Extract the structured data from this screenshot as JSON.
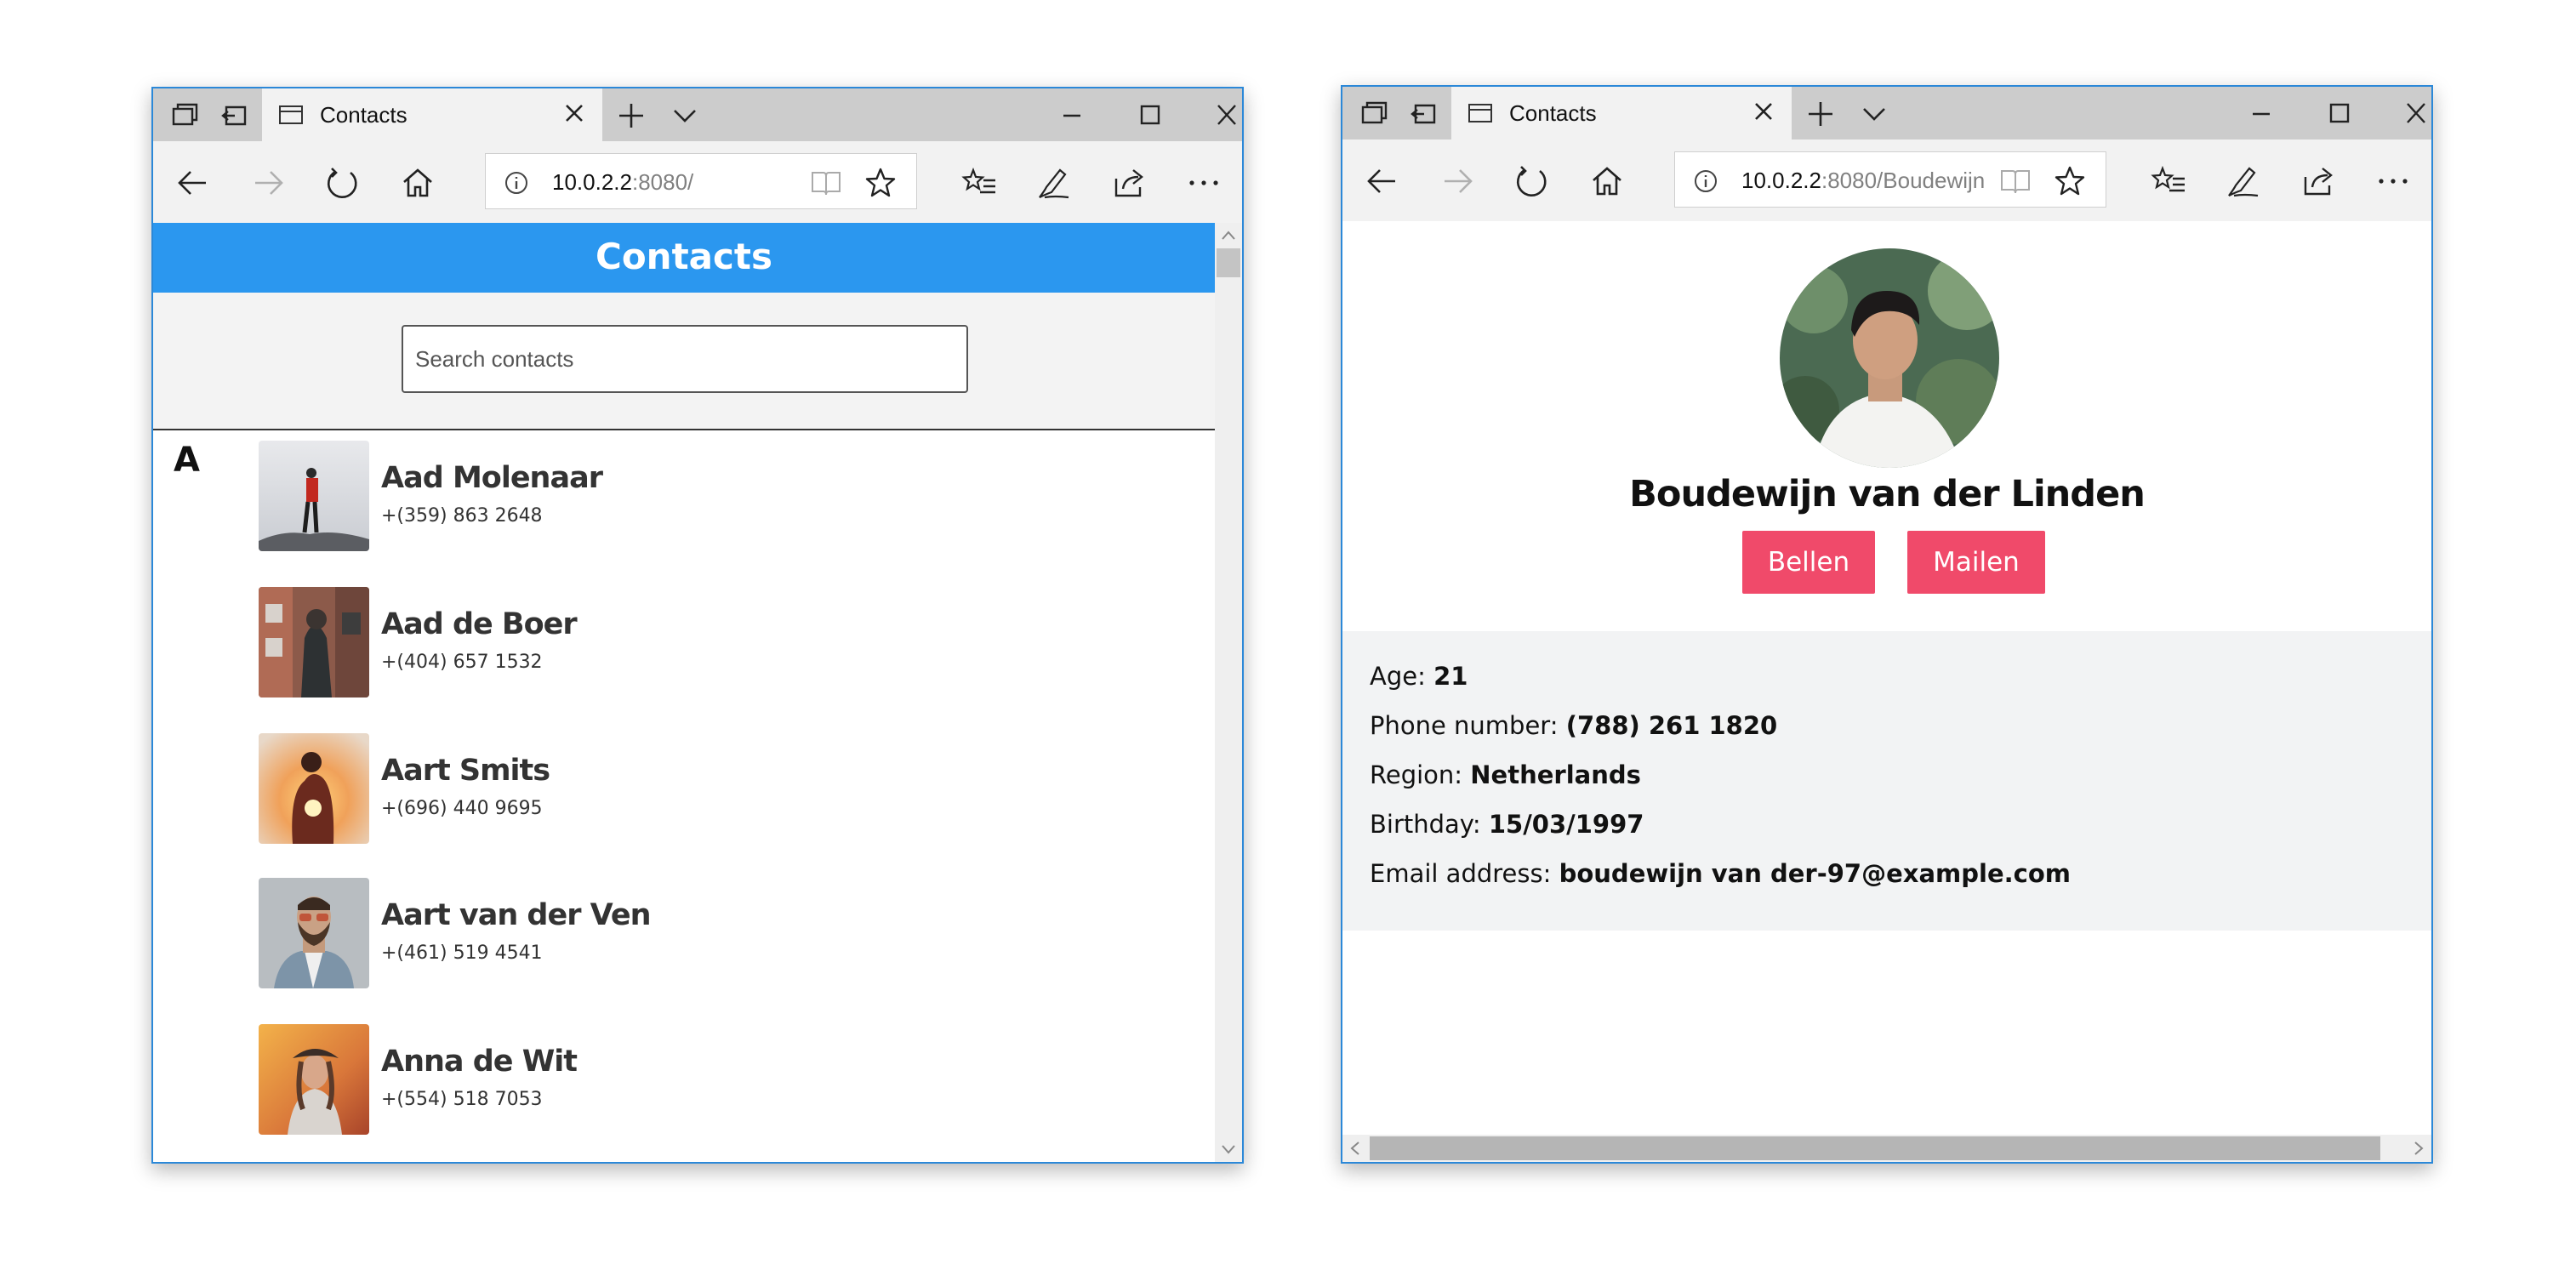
{
  "left_window": {
    "tab_title": "Contacts",
    "url_host": "10.0.2.2",
    "url_rest": ":8080/",
    "header_title": "Contacts",
    "search_placeholder": "Search contacts",
    "section_letter": "A",
    "contacts": [
      {
        "name": "Aad Molenaar",
        "phone": "+(359) 863 2648"
      },
      {
        "name": "Aad de Boer",
        "phone": "+(404) 657 1532"
      },
      {
        "name": "Aart Smits",
        "phone": "+(696) 440 9695"
      },
      {
        "name": "Aart van der Ven",
        "phone": "+(461) 519 4541"
      },
      {
        "name": "Anna de Wit",
        "phone": "+(554) 518 7053"
      }
    ]
  },
  "right_window": {
    "tab_title": "Contacts",
    "url_host": "10.0.2.2",
    "url_rest": ":8080/Boudewijn",
    "profile_name": "Boudewijn van der Linden",
    "call_button": "Bellen",
    "mail_button": "Mailen",
    "details": {
      "age_label": "Age:",
      "age_value": "21",
      "phone_label": "Phone number:",
      "phone_value": "(788) 261 1820",
      "region_label": "Region:",
      "region_value": "Netherlands",
      "birthday_label": "Birthday:",
      "birthday_value": "15/03/1997",
      "email_label": "Email address:",
      "email_value": "boudewijn van der-97@example.com"
    }
  },
  "colors": {
    "header_blue": "#2b97ef",
    "button_pink": "#f04a6a",
    "window_border": "#2b88d8"
  }
}
